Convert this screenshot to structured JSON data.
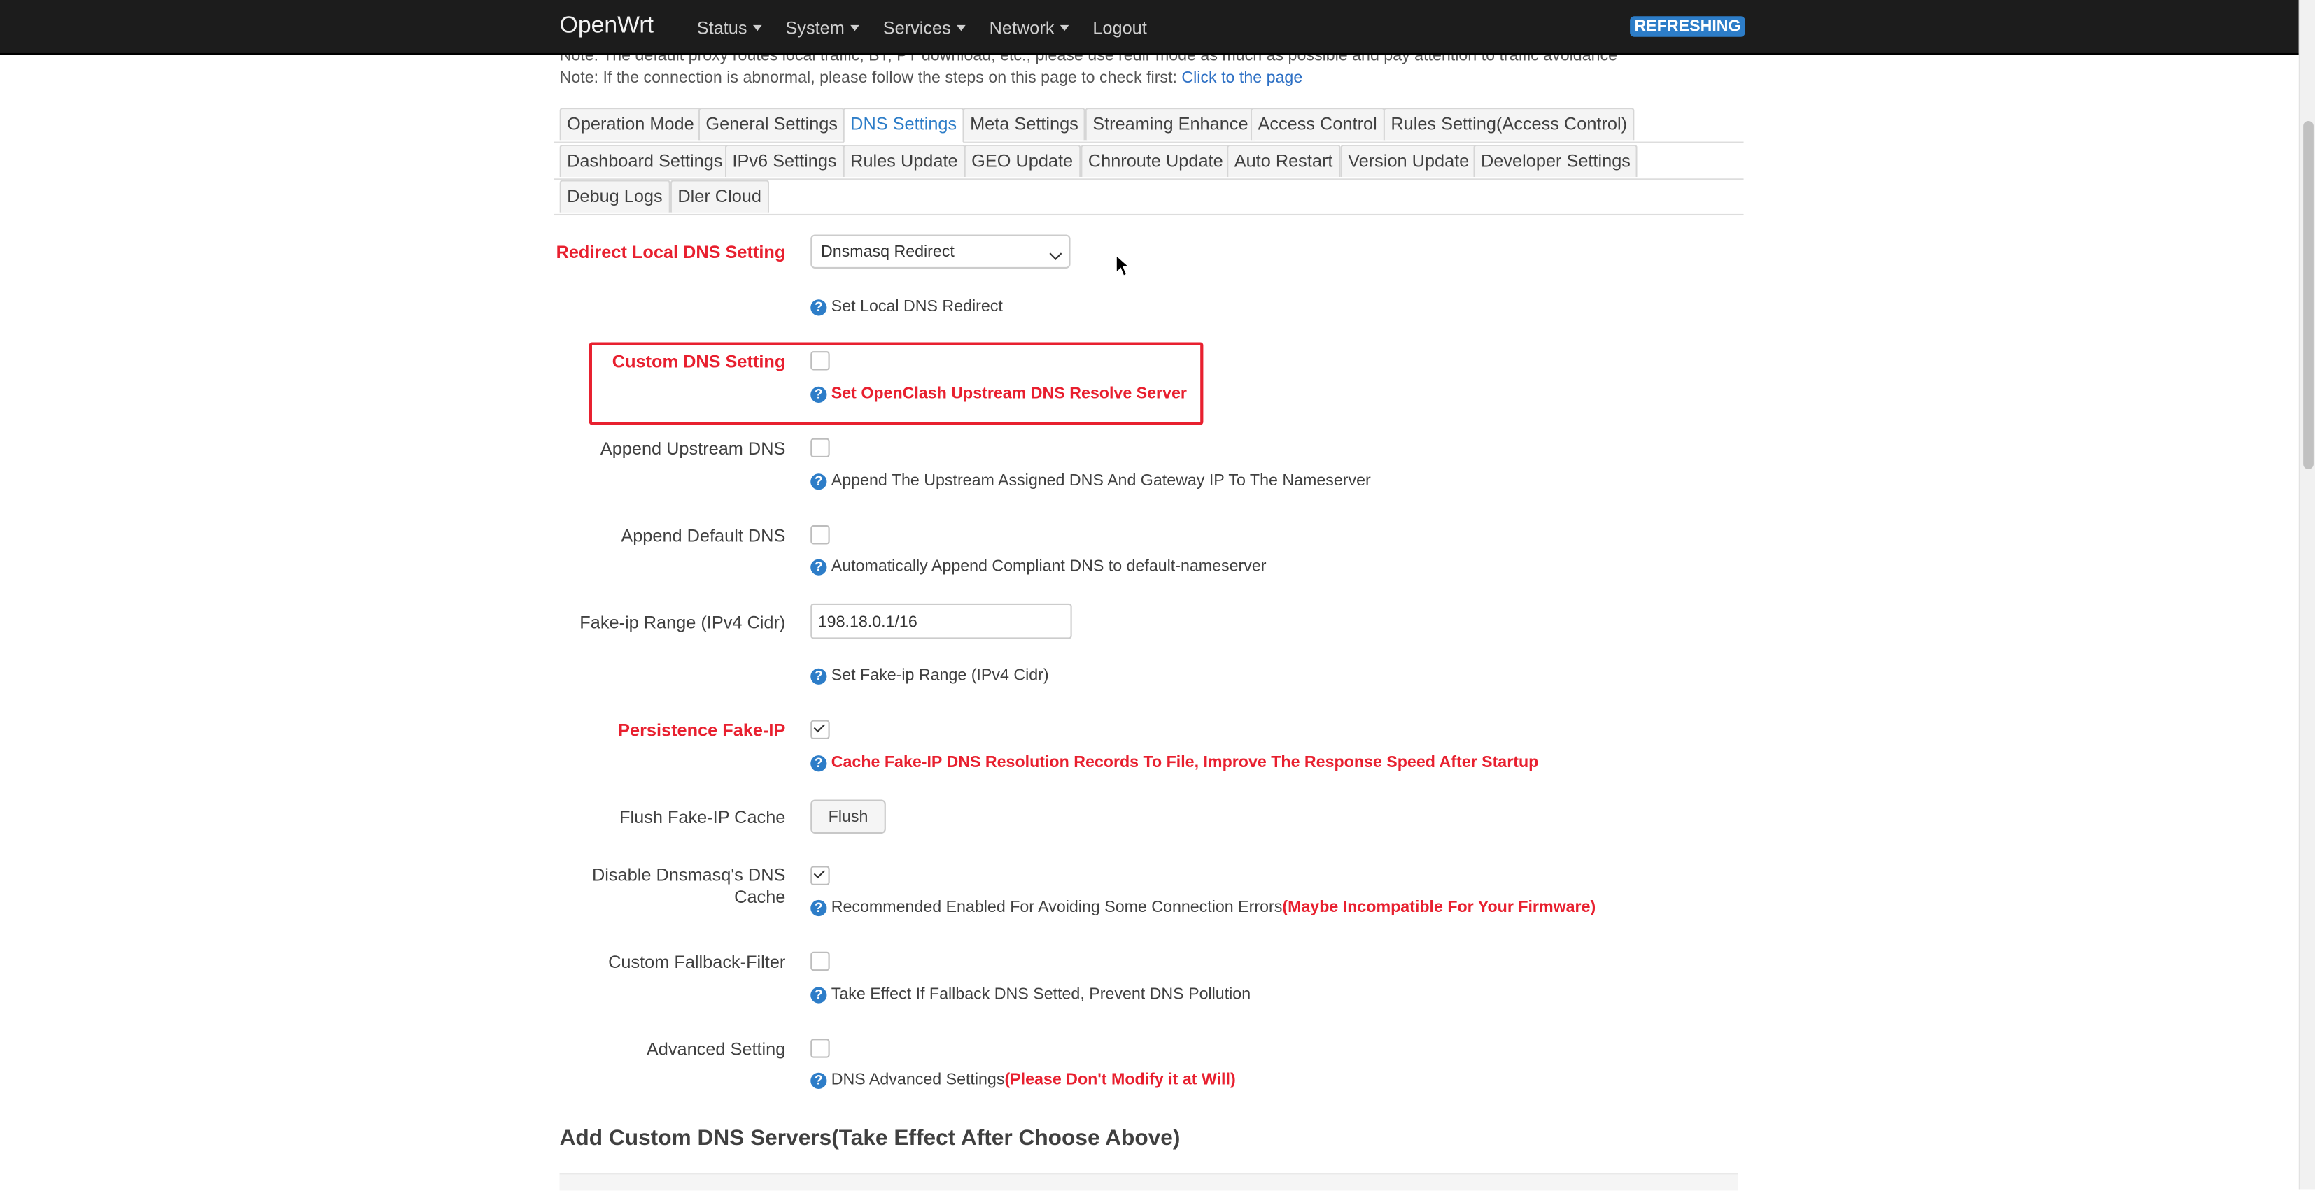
{
  "navbar": {
    "brand": "OpenWrt",
    "menus": [
      "Status",
      "System",
      "Services",
      "Network"
    ],
    "logout": "Logout",
    "badge": "REFRESHING"
  },
  "notes": {
    "line1": "Note: The default proxy routes local traffic, BT, PT download, etc., please use redir mode as much as possible and pay attention to traffic avoidance",
    "line2_prefix": "Note: If the connection is abnormal, please follow the steps on this page to check first: ",
    "line2_link": "Click to the page"
  },
  "tabs": {
    "row1": [
      "Operation Mode",
      "General Settings",
      "DNS Settings",
      "Meta Settings",
      "Streaming Enhance",
      "Access Control",
      "Rules Setting(Access Control)"
    ],
    "row2": [
      "Dashboard Settings",
      "IPv6 Settings",
      "Rules Update",
      "GEO Update",
      "Chnroute Update",
      "Auto Restart",
      "Version Update",
      "Developer Settings"
    ],
    "row3": [
      "Debug Logs",
      "Dler Cloud"
    ],
    "active": "DNS Settings"
  },
  "form": {
    "redirect_local_dns": {
      "label": "Redirect Local DNS Setting",
      "value": "Dnsmasq Redirect",
      "help": "Set Local DNS Redirect"
    },
    "custom_dns": {
      "label": "Custom DNS Setting",
      "checked": false,
      "help": "Set OpenClash Upstream DNS Resolve Server"
    },
    "append_upstream": {
      "label": "Append Upstream DNS",
      "checked": false,
      "help": "Append The Upstream Assigned DNS And Gateway IP To The Nameserver"
    },
    "append_default": {
      "label": "Append Default DNS",
      "checked": false,
      "help": "Automatically Append Compliant DNS to default-nameserver"
    },
    "fakeip_range": {
      "label": "Fake-ip Range (IPv4 Cidr)",
      "value": "198.18.0.1/16",
      "help": "Set Fake-ip Range (IPv4 Cidr)"
    },
    "persistence_fakeip": {
      "label": "Persistence Fake-IP",
      "checked": true,
      "help": "Cache Fake-IP DNS Resolution Records To File, Improve The Response Speed After Startup"
    },
    "flush_fakeip": {
      "label": "Flush Fake-IP Cache",
      "button": "Flush"
    },
    "disable_dnsmasq_cache": {
      "label": "Disable Dnsmasq's DNS Cache",
      "checked": true,
      "help": "Recommended Enabled For Avoiding Some Connection Errors",
      "help_warn": "(Maybe Incompatible For Your Firmware)"
    },
    "custom_fallback": {
      "label": "Custom Fallback-Filter",
      "checked": false,
      "help": "Take Effect If Fallback DNS Setted, Prevent DNS Pollution"
    },
    "advanced": {
      "label": "Advanced Setting",
      "checked": false,
      "help": "DNS Advanced Settings",
      "help_warn": "(Please Don't Modify it at Will)"
    }
  },
  "section_title": "Add Custom DNS Servers(Take Effect After Choose Above)",
  "icons": {
    "help": "question-circle-icon",
    "cursor": "mouse-pointer-icon"
  },
  "colors": {
    "accent": "#2d7dc8",
    "warning": "#e8202f",
    "navbar": "#1c1c1c"
  }
}
